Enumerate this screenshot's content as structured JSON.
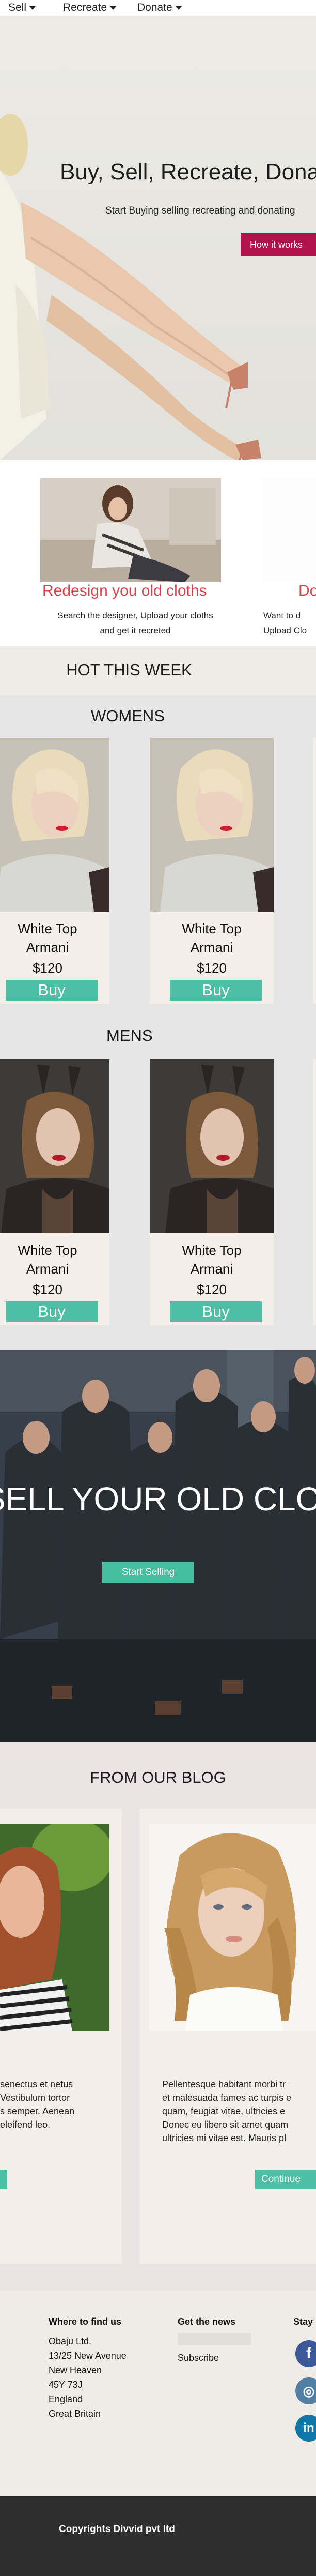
{
  "nav": {
    "items": [
      {
        "label": "Sell"
      },
      {
        "label": "Recreate"
      },
      {
        "label": "Donate"
      }
    ]
  },
  "hero": {
    "title": "Buy, Sell, Recreate, Donate",
    "subtitle": "Start Buying selling recreating and donating",
    "button_label": "How it works"
  },
  "services": {
    "item1": {
      "title": "Redesign you old cloths",
      "desc_line1": "Search the designer, Upload your cloths",
      "desc_line2": "and get it recreted"
    },
    "item2": {
      "title": "Do",
      "desc_line1": "Want to d",
      "desc_line2": "Upload Clo"
    }
  },
  "hot": {
    "title": "HOT THIS WEEK"
  },
  "womens": {
    "title": "WOMENS",
    "products": [
      {
        "name_line1": "White Top",
        "name_line2": "Armani",
        "price": "$120",
        "buy_label": "Buy"
      },
      {
        "name_line1": "White Top",
        "name_line2": "Armani",
        "price": "$120",
        "buy_label": "Buy"
      }
    ]
  },
  "mens": {
    "title": "MENS",
    "products": [
      {
        "name_line1": "White Top",
        "name_line2": "Armani",
        "price": "$120",
        "buy_label": "Buy"
      },
      {
        "name_line1": "White Top",
        "name_line2": "Armani",
        "price": "$120",
        "buy_label": "Buy"
      }
    ]
  },
  "sell_banner": {
    "title": "SELL YOUR OLD CLOTHS",
    "button_label": "Start Selling"
  },
  "blog": {
    "title": "FROM OUR BLOG",
    "posts": [
      {
        "lines": [
          "senectus et netus",
          "Vestibulum tortor",
          "s semper. Aenean",
          "eleifend leo."
        ]
      },
      {
        "lines": [
          "Pellentesque habitant morbi tr",
          "et malesuada fames ac turpis e",
          "quam, feugiat vitae, ultricies e",
          " Donec eu libero sit amet quam",
          "ultricies mi vitae est. Mauris pl"
        ],
        "more_label": "Continue"
      }
    ]
  },
  "footer": {
    "where": {
      "heading": "Where to find us",
      "lines": [
        "Obaju Ltd.",
        "13/25 New Avenue",
        "New Heaven",
        "45Y 73J",
        "England",
        "Great Britain"
      ]
    },
    "news": {
      "heading": "Get the news",
      "subscribe_label": "Subscribe"
    },
    "stay": {
      "heading": "Stay"
    },
    "social": [
      {
        "icon": "facebook-icon",
        "glyph": "f",
        "color": "#3b5998"
      },
      {
        "icon": "instagram-icon",
        "glyph": "◎",
        "color": "#517fa4"
      },
      {
        "icon": "linkedin-icon",
        "glyph": "in",
        "color": "#0e76a8"
      }
    ]
  },
  "copyright": "Copyrights Divvid pvt ltd"
}
